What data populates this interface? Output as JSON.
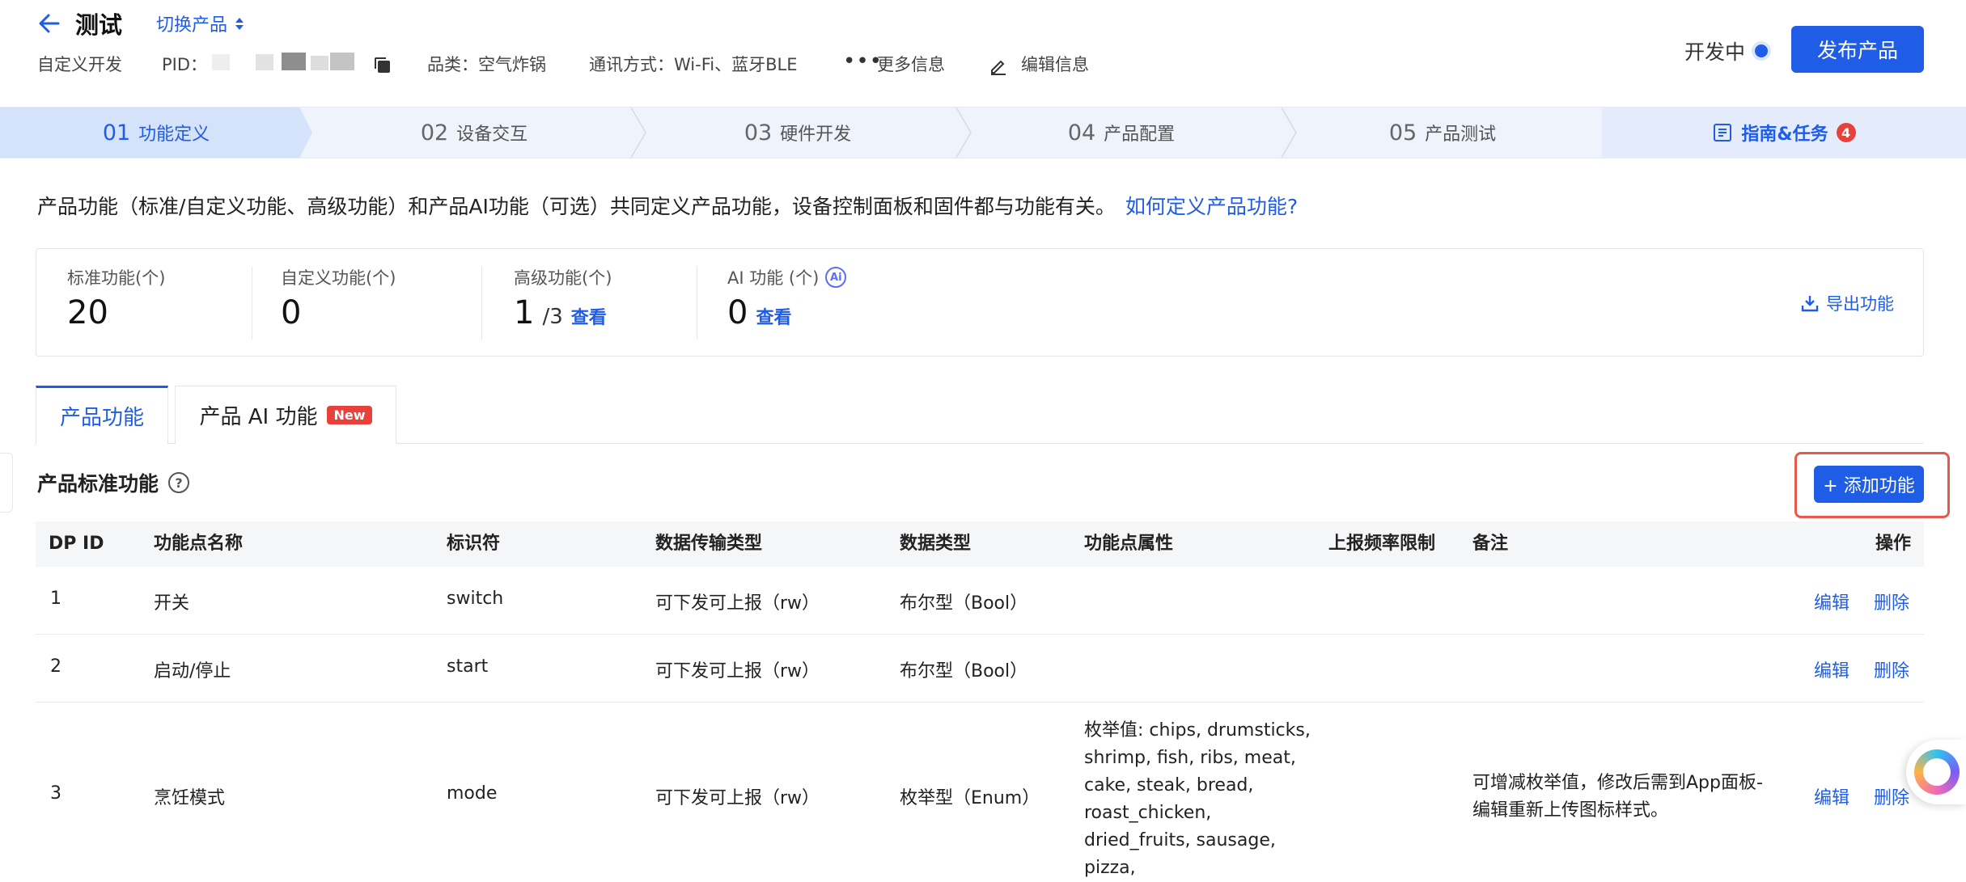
{
  "header": {
    "title": "测试",
    "switch_label": "切换产品",
    "meta": {
      "dev_type": "自定义开发",
      "pid_label": "PID：",
      "category": "品类：空气炸锅",
      "comm": "通讯方式：Wi-Fi、蓝牙BLE",
      "more_info": "更多信息",
      "edit_info": "编辑信息"
    },
    "status": "开发中",
    "publish_button": "发布产品"
  },
  "steps": [
    {
      "num": "01",
      "label": "功能定义"
    },
    {
      "num": "02",
      "label": "设备交互"
    },
    {
      "num": "03",
      "label": "硬件开发"
    },
    {
      "num": "04",
      "label": "产品配置"
    },
    {
      "num": "05",
      "label": "产品测试"
    }
  ],
  "guide": {
    "label": "指南&任务",
    "count": "4"
  },
  "intro": {
    "text": "产品功能（标准/自定义功能、高级功能）和产品AI功能（可选）共同定义产品功能，设备控制面板和固件都与功能有关。",
    "link": "如何定义产品功能?"
  },
  "stats": {
    "standard": {
      "label": "标准功能(个)",
      "value": "20"
    },
    "custom": {
      "label": "自定义功能(个)",
      "value": "0"
    },
    "advanced": {
      "label": "高级功能(个)",
      "value": "1",
      "sub": "/3",
      "link": "查看"
    },
    "ai": {
      "label": "AI 功能 (个)",
      "value": "0",
      "link": "查看"
    },
    "export": "导出功能"
  },
  "tabs": {
    "product": "产品功能",
    "ai": "产品 AI 功能",
    "new_badge": "New"
  },
  "section": {
    "title": "产品标准功能",
    "add_button": "+ 添加功能"
  },
  "table": {
    "columns": {
      "dp_id": "DP ID",
      "name": "功能点名称",
      "code": "标识符",
      "transfer": "数据传输类型",
      "type": "数据类型",
      "attr": "功能点属性",
      "freq": "上报频率限制",
      "remark": "备注",
      "ops": "操作"
    },
    "rows": [
      {
        "id": "1",
        "name": "开关",
        "code": "switch",
        "transfer": "可下发可上报（rw）",
        "type": "布尔型（Bool）",
        "edit": "编辑",
        "delete": "删除"
      },
      {
        "id": "2",
        "name": "启动/停止",
        "code": "start",
        "transfer": "可下发可上报（rw）",
        "type": "布尔型（Bool）",
        "edit": "编辑",
        "delete": "删除"
      },
      {
        "id": "3",
        "name": "烹饪模式",
        "code": "mode",
        "transfer": "可下发可上报（rw）",
        "type": "枚举型（Enum）",
        "attr": [
          "枚举值: chips, drumsticks,",
          "shrimp, fish, ribs, meat,",
          "cake, steak, bread,",
          "roast_chicken,",
          "dried_fruits, sausage,",
          "pizza,"
        ],
        "remark": [
          "可增减枚举值，修改后需到App面板-",
          "编辑重新上传图标样式。"
        ],
        "edit": "编辑",
        "delete": "删除"
      }
    ]
  },
  "colors": {
    "accent": "#1f5de6",
    "danger": "#e8403b",
    "highlight_box": "#e55a4c",
    "step_bg": "#eef3fc"
  }
}
